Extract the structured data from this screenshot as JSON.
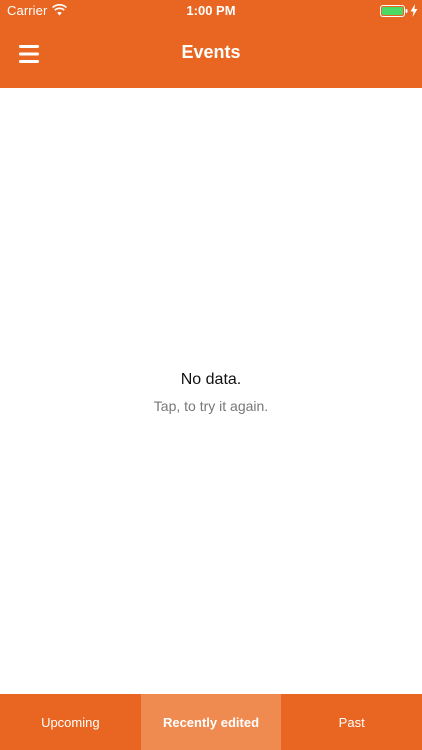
{
  "status_bar": {
    "carrier": "Carrier",
    "time": "1:00 PM",
    "wifi_icon": "wifi-icon",
    "battery_icon": "battery-charging-icon"
  },
  "nav_bar": {
    "title": "Events",
    "menu_icon": "hamburger-menu-icon"
  },
  "empty_state": {
    "title": "No data.",
    "subtitle": "Tap, to try it again."
  },
  "tabs": [
    {
      "label": "Upcoming",
      "active": false
    },
    {
      "label": "Recently edited",
      "active": true
    },
    {
      "label": "Past",
      "active": false
    }
  ],
  "colors": {
    "accent": "#e86621",
    "active_tab": "#ef8a50",
    "battery_fill": "#4cd964"
  }
}
